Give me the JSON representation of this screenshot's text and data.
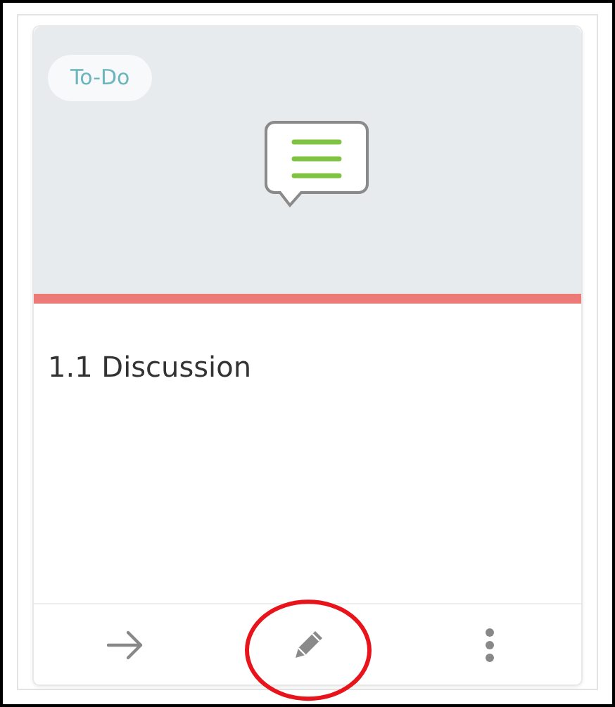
{
  "card": {
    "status": "To-Do",
    "title": "1.1 Discussion",
    "actions": [
      {
        "kind": "open",
        "highlighted": false
      },
      {
        "kind": "edit",
        "highlighted": true
      },
      {
        "kind": "more",
        "highlighted": false
      }
    ]
  }
}
